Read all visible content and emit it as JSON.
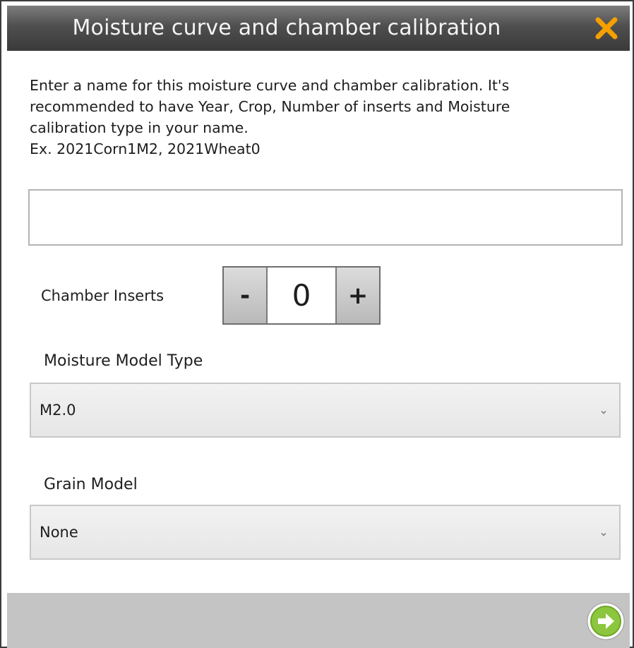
{
  "dialog": {
    "title": "Moisture curve and chamber calibration",
    "close_icon": "close-icon",
    "accent_color": "#f5a000"
  },
  "instructions": {
    "lines": [
      "Enter a name for this moisture curve and chamber calibration. It's",
      "recommended to have Year, Crop, Number of inserts and Moisture",
      "calibration type in your name.",
      "Ex. 2021Corn1M2, 2021Wheat0"
    ]
  },
  "name_input": {
    "value": ""
  },
  "chamber_inserts": {
    "label": "Chamber Inserts",
    "decrement_label": "-",
    "value": "0",
    "increment_label": "+"
  },
  "moisture_model": {
    "label": "Moisture Model Type",
    "selected": "M2.0",
    "chevron_icon": "chevron-down-icon"
  },
  "grain_model": {
    "label": "Grain Model",
    "selected": "None",
    "chevron_icon": "chevron-down-icon"
  },
  "footer": {
    "next_icon": "arrow-right-circle-icon",
    "next_color": "#8cc63f"
  }
}
